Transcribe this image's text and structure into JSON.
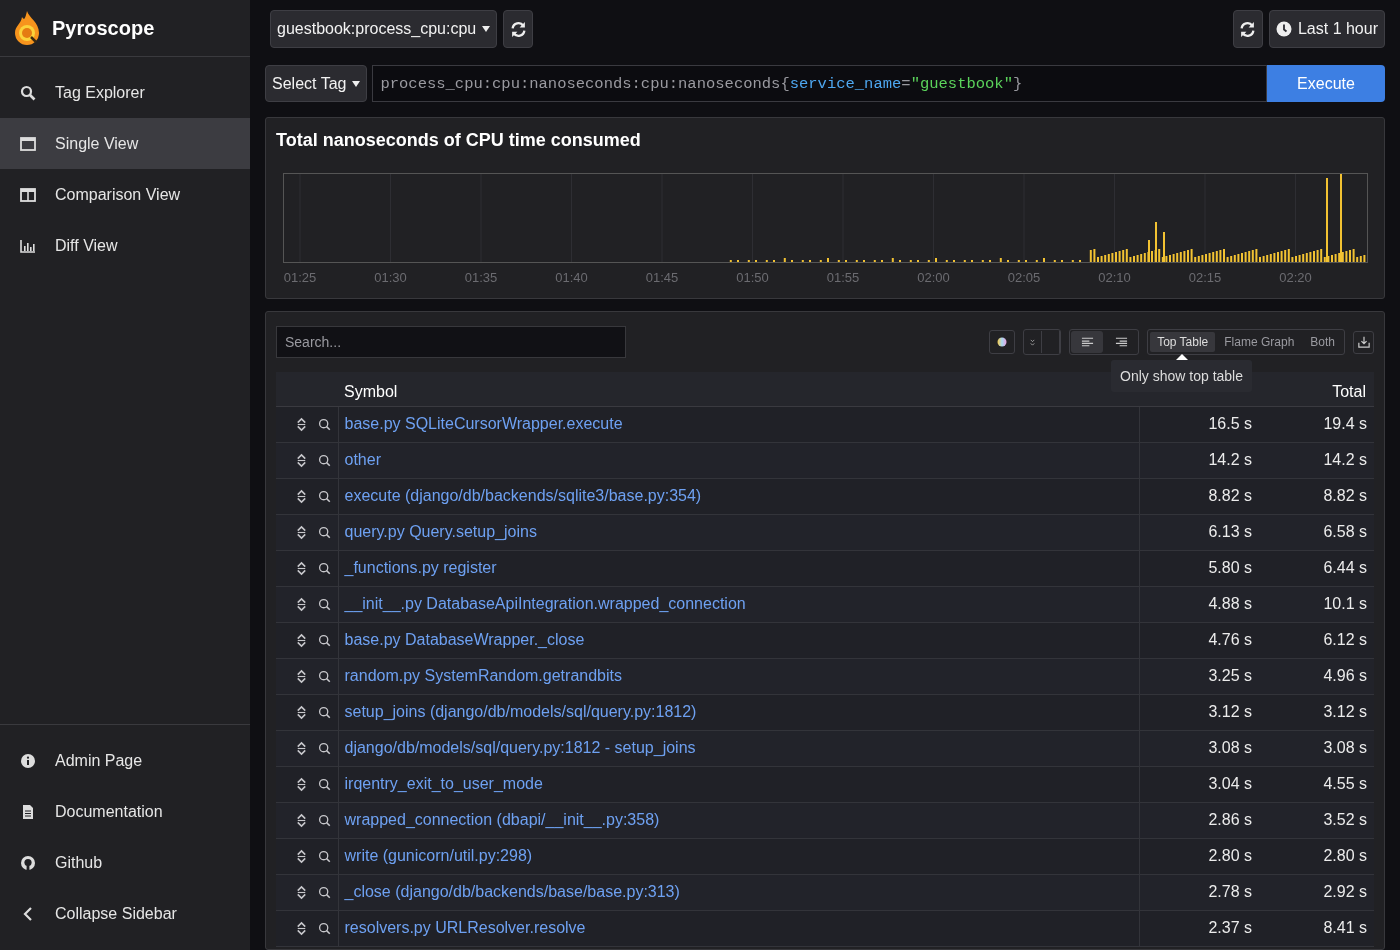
{
  "sidebar": {
    "brand": "Pyroscope",
    "items": [
      {
        "label": "Tag Explorer",
        "selected": false
      },
      {
        "label": "Single View",
        "selected": true
      },
      {
        "label": "Comparison View",
        "selected": false
      },
      {
        "label": "Diff View",
        "selected": false
      }
    ],
    "bottom_items": [
      {
        "label": "Admin Page"
      },
      {
        "label": "Documentation"
      },
      {
        "label": "Github"
      },
      {
        "label": "Collapse Sidebar"
      }
    ]
  },
  "toolbar": {
    "app_select": "guestbook:process_cpu:cpu",
    "time_range": "Last 1 hour"
  },
  "query": {
    "tag_button": "Select Tag",
    "segments": [
      {
        "kind": "plain",
        "text": "process_cpu:cpu:nanoseconds:cpu:nanoseconds{"
      },
      {
        "kind": "key",
        "text": "service_name"
      },
      {
        "kind": "plain",
        "text": "="
      },
      {
        "kind": "value",
        "text": "\"guestbook\""
      },
      {
        "kind": "plain",
        "text": "}"
      }
    ],
    "execute": "Execute"
  },
  "timeline": {
    "title": "Total nanoseconds of CPU time consumed",
    "x_labels": [
      "01:25",
      "01:30",
      "01:35",
      "01:40",
      "01:45",
      "01:50",
      "01:55",
      "02:00",
      "02:05",
      "02:10",
      "02:15",
      "02:20"
    ]
  },
  "table_panel": {
    "search": {
      "placeholder": "Search..."
    },
    "view_modes": [
      {
        "label": "Top Table",
        "selected": true
      },
      {
        "label": "Flame Graph",
        "selected": false
      },
      {
        "label": "Both",
        "selected": false
      }
    ],
    "tooltip": "Only show top table",
    "columns": [
      "Symbol",
      "Total"
    ],
    "rows": [
      {
        "symbol": "base.py SQLiteCursorWrapper.execute",
        "self": "16.5 s",
        "total": "19.4 s"
      },
      {
        "symbol": "other",
        "self": "14.2 s",
        "total": "14.2 s"
      },
      {
        "symbol": "execute (django/db/backends/sqlite3/base.py:354)",
        "self": "8.82 s",
        "total": "8.82 s"
      },
      {
        "symbol": "query.py Query.setup_joins",
        "self": "6.13 s",
        "total": "6.58 s"
      },
      {
        "symbol": "_functions.py register",
        "self": "5.80 s",
        "total": "6.44 s"
      },
      {
        "symbol": "__init__.py DatabaseApiIntegration.wrapped_connection",
        "self": "4.88 s",
        "total": "10.1 s"
      },
      {
        "symbol": "base.py DatabaseWrapper._close",
        "self": "4.76 s",
        "total": "6.12 s"
      },
      {
        "symbol": "random.py SystemRandom.getrandbits",
        "self": "3.25 s",
        "total": "4.96 s"
      },
      {
        "symbol": "setup_joins (django/db/models/sql/query.py:1812)",
        "self": "3.12 s",
        "total": "3.12 s"
      },
      {
        "symbol": "django/db/models/sql/query.py:1812 - setup_joins",
        "self": "3.08 s",
        "total": "3.08 s"
      },
      {
        "symbol": "irqentry_exit_to_user_mode",
        "self": "3.04 s",
        "total": "4.55 s"
      },
      {
        "symbol": "wrapped_connection (dbapi/__init__.py:358)",
        "self": "2.86 s",
        "total": "3.52 s"
      },
      {
        "symbol": "write (gunicorn/util.py:298)",
        "self": "2.80 s",
        "total": "2.80 s"
      },
      {
        "symbol": "_close (django/db/backends/base/base.py:313)",
        "self": "2.78 s",
        "total": "2.92 s"
      },
      {
        "symbol": "resolvers.py URLResolver.resolve",
        "self": "2.37 s",
        "total": "8.41 s"
      }
    ]
  }
}
